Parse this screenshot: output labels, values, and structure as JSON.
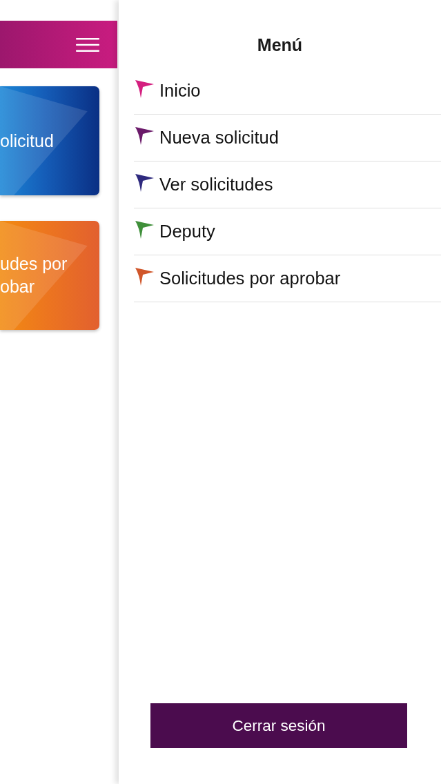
{
  "main": {
    "cards": [
      {
        "kind": "blue",
        "label": "olicitud"
      },
      {
        "kind": "orange",
        "label": "udes por\nobar"
      }
    ]
  },
  "drawer": {
    "title": "Menú",
    "items": [
      {
        "label": "Inicio",
        "color": "#d41f7f"
      },
      {
        "label": "Nueva solicitud",
        "color": "#6b1a6a"
      },
      {
        "label": "Ver solicitudes",
        "color": "#2e2a7e"
      },
      {
        "label": "Deputy",
        "color": "#3f8f3a"
      },
      {
        "label": "Solicitudes por aprobar",
        "color": "#d0562a"
      }
    ],
    "logout_button": "Cerrar sesión"
  }
}
